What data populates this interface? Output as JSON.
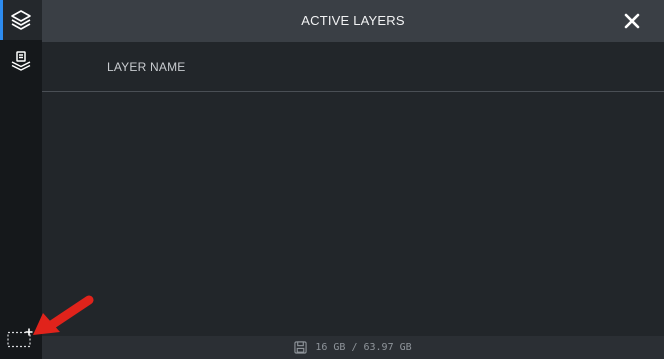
{
  "panel": {
    "title": "ACTIVE LAYERS"
  },
  "table": {
    "column_header": "LAYER NAME",
    "rows": []
  },
  "status": {
    "storage": "16 GB / 63.97 GB"
  },
  "sidebar": {
    "items": [
      {
        "icon": "layers-icon",
        "active": true
      },
      {
        "icon": "layer-export-icon",
        "active": false
      }
    ]
  },
  "colors": {
    "accent": "#2d8cf0",
    "annotation_arrow": "#e0231b",
    "header_bg": "#3a3f45",
    "sidebar_bg": "#15181b",
    "panel_bg": "#22262a"
  }
}
